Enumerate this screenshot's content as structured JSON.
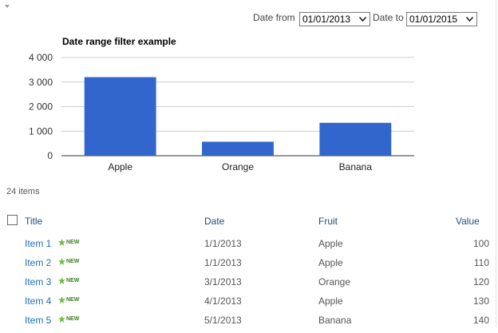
{
  "filter": {
    "date_from_label": "Date from",
    "date_from_value": "01/01/2013",
    "date_to_label": "Date to",
    "date_to_value": "01/01/2015"
  },
  "chart_data": {
    "type": "bar",
    "title": "Date range filter example",
    "categories": [
      "Apple",
      "Orange",
      "Banana"
    ],
    "values": [
      3200,
      570,
      1340
    ],
    "ylim": [
      0,
      4000
    ],
    "yticks": [
      0,
      1000,
      2000,
      3000,
      4000
    ],
    "ytick_labels": [
      "0",
      "1 000",
      "2 000",
      "3 000",
      "4 000"
    ],
    "bar_color": "#3366cc",
    "grid": true,
    "legend": "none"
  },
  "list": {
    "items_count": "24 items",
    "columns": {
      "title": "Title",
      "date": "Date",
      "fruit": "Fruit",
      "value": "Value"
    },
    "new_badge": "NEW",
    "rows": [
      {
        "title": "Item 1",
        "date": "1/1/2013",
        "fruit": "Apple",
        "value": "100"
      },
      {
        "title": "Item 2",
        "date": "1/1/2013",
        "fruit": "Apple",
        "value": "110"
      },
      {
        "title": "Item 3",
        "date": "3/1/2013",
        "fruit": "Orange",
        "value": "120"
      },
      {
        "title": "Item 4",
        "date": "4/1/2013",
        "fruit": "Apple",
        "value": "130"
      },
      {
        "title": "Item 5",
        "date": "5/1/2013",
        "fruit": "Banana",
        "value": "140"
      }
    ]
  },
  "colors": {
    "link": "#1f6fb2",
    "header": "#1f4e79",
    "new_badge": "#3b7d1b"
  }
}
